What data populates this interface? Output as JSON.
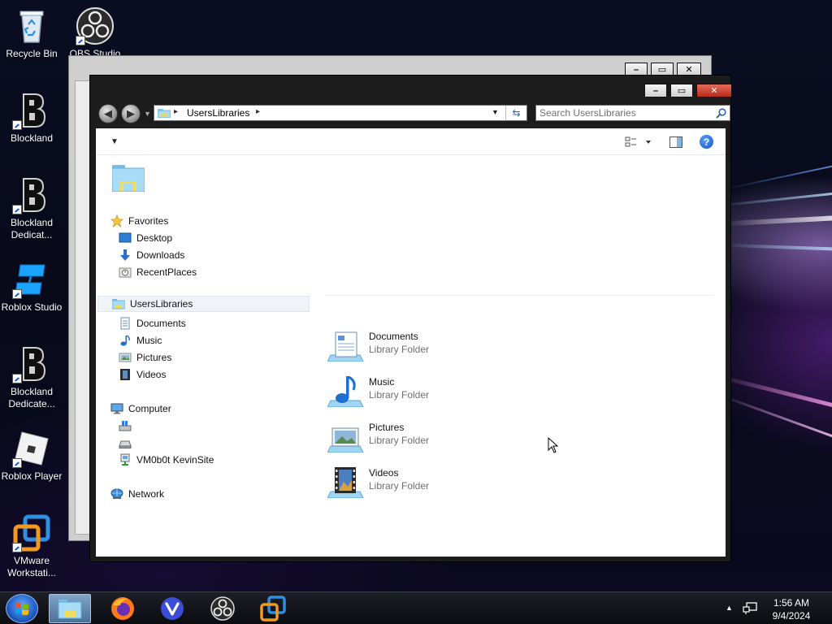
{
  "desktop": {
    "icons": [
      {
        "label": "Recycle Bin",
        "icon": "recycle-bin-icon"
      },
      {
        "label": "OBS Studio",
        "icon": "obs-icon"
      },
      {
        "label": "Blockland",
        "icon": "blockland-icon"
      },
      {
        "label": "Blockland Dedicat...",
        "icon": "blockland-icon"
      },
      {
        "label": "Roblox Studio",
        "icon": "roblox-studio-icon"
      },
      {
        "label": "Blockland Dedicate...",
        "icon": "blockland-icon"
      },
      {
        "label": "Roblox Player",
        "icon": "roblox-player-icon"
      },
      {
        "label": "VMware Workstati...",
        "icon": "vmware-icon"
      }
    ]
  },
  "window": {
    "minimize_label": "–",
    "maximize_label": "▭",
    "close_label": "✕",
    "address": {
      "path_label": "UsersLibraries"
    },
    "search": {
      "placeholder": "Search UsersLibraries"
    },
    "help_label": "?",
    "nav_pane": {
      "favorites": {
        "label": "Favorites",
        "items": [
          {
            "label": "Desktop",
            "icon": "desktop-icon"
          },
          {
            "label": "Downloads",
            "icon": "downloads-icon"
          },
          {
            "label": "RecentPlaces",
            "icon": "recent-places-icon"
          }
        ]
      },
      "libraries": {
        "label": "UsersLibraries",
        "items": [
          {
            "label": "Documents",
            "icon": "documents-icon"
          },
          {
            "label": "Music",
            "icon": "music-icon"
          },
          {
            "label": "Pictures",
            "icon": "pictures-icon"
          },
          {
            "label": "Videos",
            "icon": "videos-icon"
          }
        ]
      },
      "computer": {
        "label": "Computer",
        "items": [
          {
            "label": "",
            "icon": "local-disk-icon"
          },
          {
            "label": "",
            "icon": "drive-icon"
          },
          {
            "label": "VM0b0t KevinSite",
            "icon": "network-drive-icon"
          }
        ]
      },
      "network": {
        "label": "Network"
      }
    },
    "content": {
      "items": [
        {
          "name": "Documents",
          "type": "Library Folder",
          "icon": "documents-library-icon"
        },
        {
          "name": "Music",
          "type": "Library Folder",
          "icon": "music-library-icon"
        },
        {
          "name": "Pictures",
          "type": "Library Folder",
          "icon": "pictures-library-icon"
        },
        {
          "name": "Videos",
          "type": "Library Folder",
          "icon": "videos-library-icon"
        }
      ]
    }
  },
  "taskbar": {
    "apps": [
      {
        "name": "File Explorer",
        "icon": "folder-icon",
        "active": true
      },
      {
        "name": "Firefox",
        "icon": "firefox-icon",
        "active": false
      },
      {
        "name": "Vivaldi",
        "icon": "vivaldi-icon",
        "active": false
      },
      {
        "name": "OBS Studio",
        "icon": "obs-icon",
        "active": false
      },
      {
        "name": "VMware Workstation",
        "icon": "vmware-icon",
        "active": false
      }
    ],
    "clock": {
      "time": "1:56 AM",
      "date": "9/4/2024"
    }
  },
  "colors": {
    "titlebar": "#1c1c1c",
    "close_button": "#c8402c",
    "selection": "#f0f4f8",
    "library_type_text": "#6d6d6d"
  }
}
